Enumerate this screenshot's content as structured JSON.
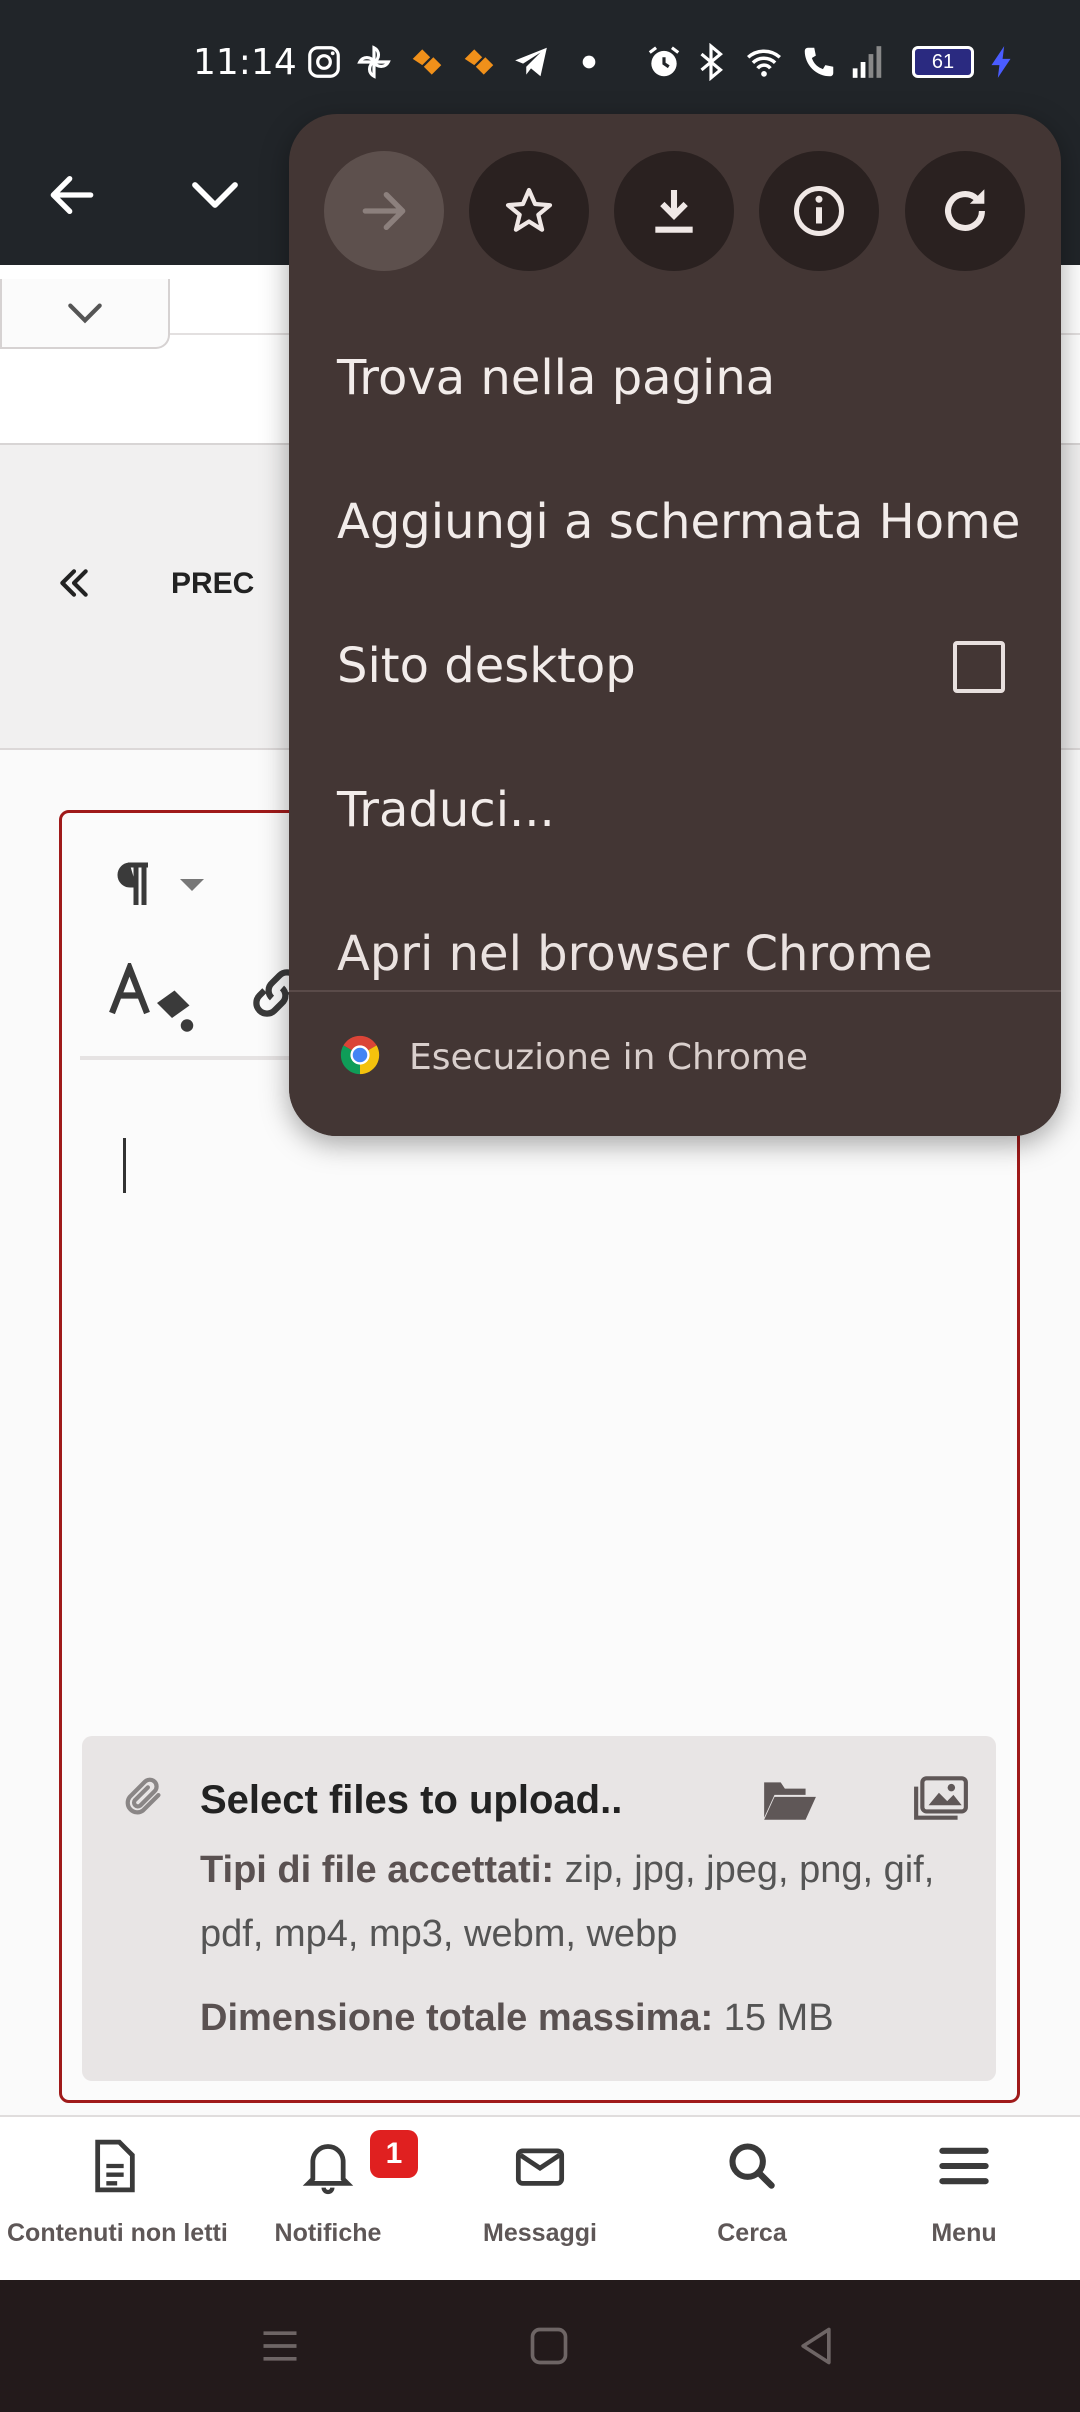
{
  "status_bar": {
    "time": "11:14",
    "battery": "61",
    "icons": [
      "instagram-icon",
      "pinwheel-icon",
      "app-heart-icon",
      "app-heart-icon",
      "telegram-icon",
      "dot-icon",
      "alarm-icon",
      "bluetooth-icon",
      "wifi-icon",
      "call-icon",
      "signal-icon",
      "battery-icon",
      "charging-icon"
    ]
  },
  "toolbar": {
    "icons": [
      "back-arrow-icon",
      "chevron-down-icon"
    ]
  },
  "pagination": {
    "prev_label": "PREC"
  },
  "upload": {
    "title": "Select files to upload..",
    "types_label": "Tipi di file accettati:",
    "types_value": " zip, jpg, jpeg, png, gif, pdf, mp4, mp3, webm, webp",
    "size_label": "Dimensione totale massima:",
    "size_value": " 15 MB"
  },
  "bottom_nav": {
    "items": [
      {
        "label": "Contenuti non letti",
        "icon": "document-icon"
      },
      {
        "label": "Notifiche",
        "icon": "bell-icon"
      },
      {
        "label": "Messaggi",
        "icon": "envelope-icon"
      },
      {
        "label": "Cerca",
        "icon": "search-icon"
      },
      {
        "label": "Menu",
        "icon": "hamburger-icon"
      }
    ],
    "notification_badge": "1"
  },
  "menu": {
    "action_icons": [
      "forward-arrow-icon",
      "star-icon",
      "download-icon",
      "info-icon",
      "refresh-icon"
    ],
    "items": [
      {
        "label": "Trova nella pagina"
      },
      {
        "label": "Aggiungi a schermata Home"
      },
      {
        "label": "Sito desktop",
        "checked": false
      },
      {
        "label": "Traduci..."
      },
      {
        "label": "Apri nel browser Chrome"
      }
    ],
    "footer": "Esecuzione in Chrome"
  }
}
